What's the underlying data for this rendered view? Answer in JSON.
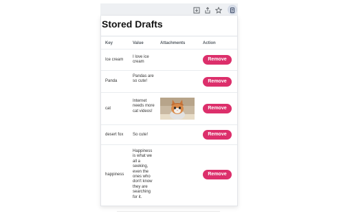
{
  "browser": {
    "toolbar_icons": [
      "download-icon",
      "share-icon",
      "bookmark-star-icon",
      "extension-icon"
    ]
  },
  "popup": {
    "title": "Stored Drafts",
    "columns": {
      "key": "Key",
      "value": "Value",
      "attachments": "Attachments",
      "action": "Action"
    },
    "rows": [
      {
        "key": "Ice cream",
        "value": "I love ice cream",
        "attachment": null,
        "action": "Remove"
      },
      {
        "key": "Panda",
        "value": "Pandas are so cute!",
        "attachment": null,
        "action": "Remove"
      },
      {
        "key": "cat",
        "value": "Internet needs more cat videos!",
        "attachment": "kitten-photo",
        "action": "Remove"
      },
      {
        "key": "desert fox",
        "value": "So cute!",
        "attachment": null,
        "action": "Remove"
      },
      {
        "key": "happiness",
        "value": "Happiness is what we all a seeking, even the ones who don't know they are searching for it.",
        "attachment": null,
        "action": "Remove"
      }
    ]
  },
  "colors": {
    "accent": "#dc2f6b",
    "toolbar_bg": "#eef0f3",
    "header_text": "#555c63"
  }
}
